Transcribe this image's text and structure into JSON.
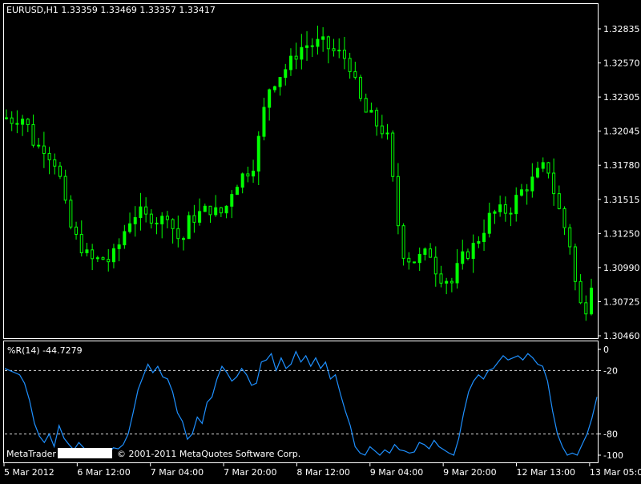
{
  "colors": {
    "background": "#000000",
    "frame": "#ffffff",
    "candle": "#00ff00",
    "indicator_line": "#1e90ff",
    "level_line": "#ffffff",
    "text": "#ffffff"
  },
  "main_chart": {
    "title": "EURUSD,H1  1.33359 1.33469 1.33357 1.33417",
    "price_labels": [
      "1.32835",
      "1.32570",
      "1.32305",
      "1.32045",
      "1.31780",
      "1.31515",
      "1.31250",
      "1.30990",
      "1.30725",
      "1.30460"
    ]
  },
  "indicator": {
    "title": "%R(14) -44.7279",
    "levels": [
      "0",
      "-20",
      "-80",
      "-100"
    ]
  },
  "time_labels": [
    "5 Mar 2012",
    "6 Mar 12:00",
    "7 Mar 04:00",
    "7 Mar 20:00",
    "8 Mar 12:00",
    "9 Mar 04:00",
    "9 Mar 20:00",
    "12 Mar 13:00",
    "13 Mar 05:00"
  ],
  "watermark": {
    "brand": "MetaTrader",
    "copyright": "© 2001-2011 MetaQuotes Software Corp."
  },
  "chart_data": [
    {
      "type": "candlestick",
      "symbol": "EURUSD",
      "timeframe": "H1",
      "ohlc_header": {
        "open": 1.33359,
        "high": 1.33469,
        "low": 1.33357,
        "close": 1.33417
      },
      "ylim": [
        1.3046,
        1.3291
      ],
      "x_ticks": [
        "5 Mar 2012",
        "6 Mar 12:00",
        "7 Mar 04:00",
        "7 Mar 20:00",
        "8 Mar 12:00",
        "9 Mar 04:00",
        "9 Mar 20:00",
        "12 Mar 13:00",
        "13 Mar 05:00"
      ],
      "close_path": [
        1.322,
        1.3218,
        1.3222,
        1.3212,
        1.3196,
        1.3198,
        1.319,
        1.3182,
        1.315,
        1.3128,
        1.312,
        1.311,
        1.3105,
        1.3108,
        1.3106,
        1.3112,
        1.3128,
        1.314,
        1.3145,
        1.314,
        1.3142,
        1.3136,
        1.3145,
        1.3128,
        1.312,
        1.3138,
        1.3142,
        1.3145,
        1.3148,
        1.3142,
        1.3148,
        1.3165,
        1.3172,
        1.3178,
        1.3185,
        1.322,
        1.3245,
        1.3252,
        1.3258,
        1.3265,
        1.3275,
        1.3278,
        1.3278,
        1.328,
        1.3276,
        1.3272,
        1.327,
        1.3262,
        1.324,
        1.3225,
        1.322,
        1.3212,
        1.3208,
        1.3162,
        1.3115,
        1.3108,
        1.3106,
        1.311,
        1.3112,
        1.3095,
        1.3092,
        1.3088,
        1.3105,
        1.3112,
        1.3118,
        1.3128,
        1.314,
        1.3145,
        1.3145,
        1.3148,
        1.3158,
        1.3165,
        1.317,
        1.3178,
        1.3182,
        1.3158,
        1.3138,
        1.3122,
        1.308,
        1.3062,
        1.309
      ]
    },
    {
      "type": "line",
      "name": "%R(14)",
      "last_value": -44.7279,
      "ylim": [
        -100,
        0
      ],
      "levels": [
        -20,
        -80
      ],
      "values": [
        -18,
        -20,
        -22,
        -24,
        -32,
        -48,
        -70,
        -82,
        -88,
        -80,
        -92,
        -72,
        -84,
        -90,
        -95,
        -88,
        -93,
        -98,
        -100,
        -97,
        -99,
        -98,
        -93,
        -94,
        -90,
        -80,
        -60,
        -38,
        -26,
        -14,
        -22,
        -16,
        -26,
        -28,
        -40,
        -60,
        -68,
        -85,
        -80,
        -64,
        -70,
        -50,
        -45,
        -28,
        -16,
        -22,
        -30,
        -26,
        -18,
        -24,
        -34,
        -32,
        -12,
        -10,
        -4,
        -20,
        -8,
        -18,
        -14,
        -2,
        -12,
        -6,
        -16,
        -8,
        -18,
        -12,
        -28,
        -24,
        -42,
        -58,
        -72,
        -92,
        -98,
        -100,
        -92,
        -96,
        -100,
        -95,
        -98,
        -90,
        -95,
        -96,
        -98,
        -97,
        -88,
        -90,
        -94,
        -86,
        -92,
        -95,
        -98,
        -100,
        -84,
        -60,
        -40,
        -30,
        -24,
        -28,
        -20,
        -18,
        -12,
        -6,
        -10,
        -8,
        -6,
        -10,
        -4,
        -8,
        -14,
        -16,
        -30,
        -58,
        -80,
        -92,
        -100,
        -98,
        -100,
        -90,
        -80,
        -65,
        -45
      ]
    }
  ]
}
